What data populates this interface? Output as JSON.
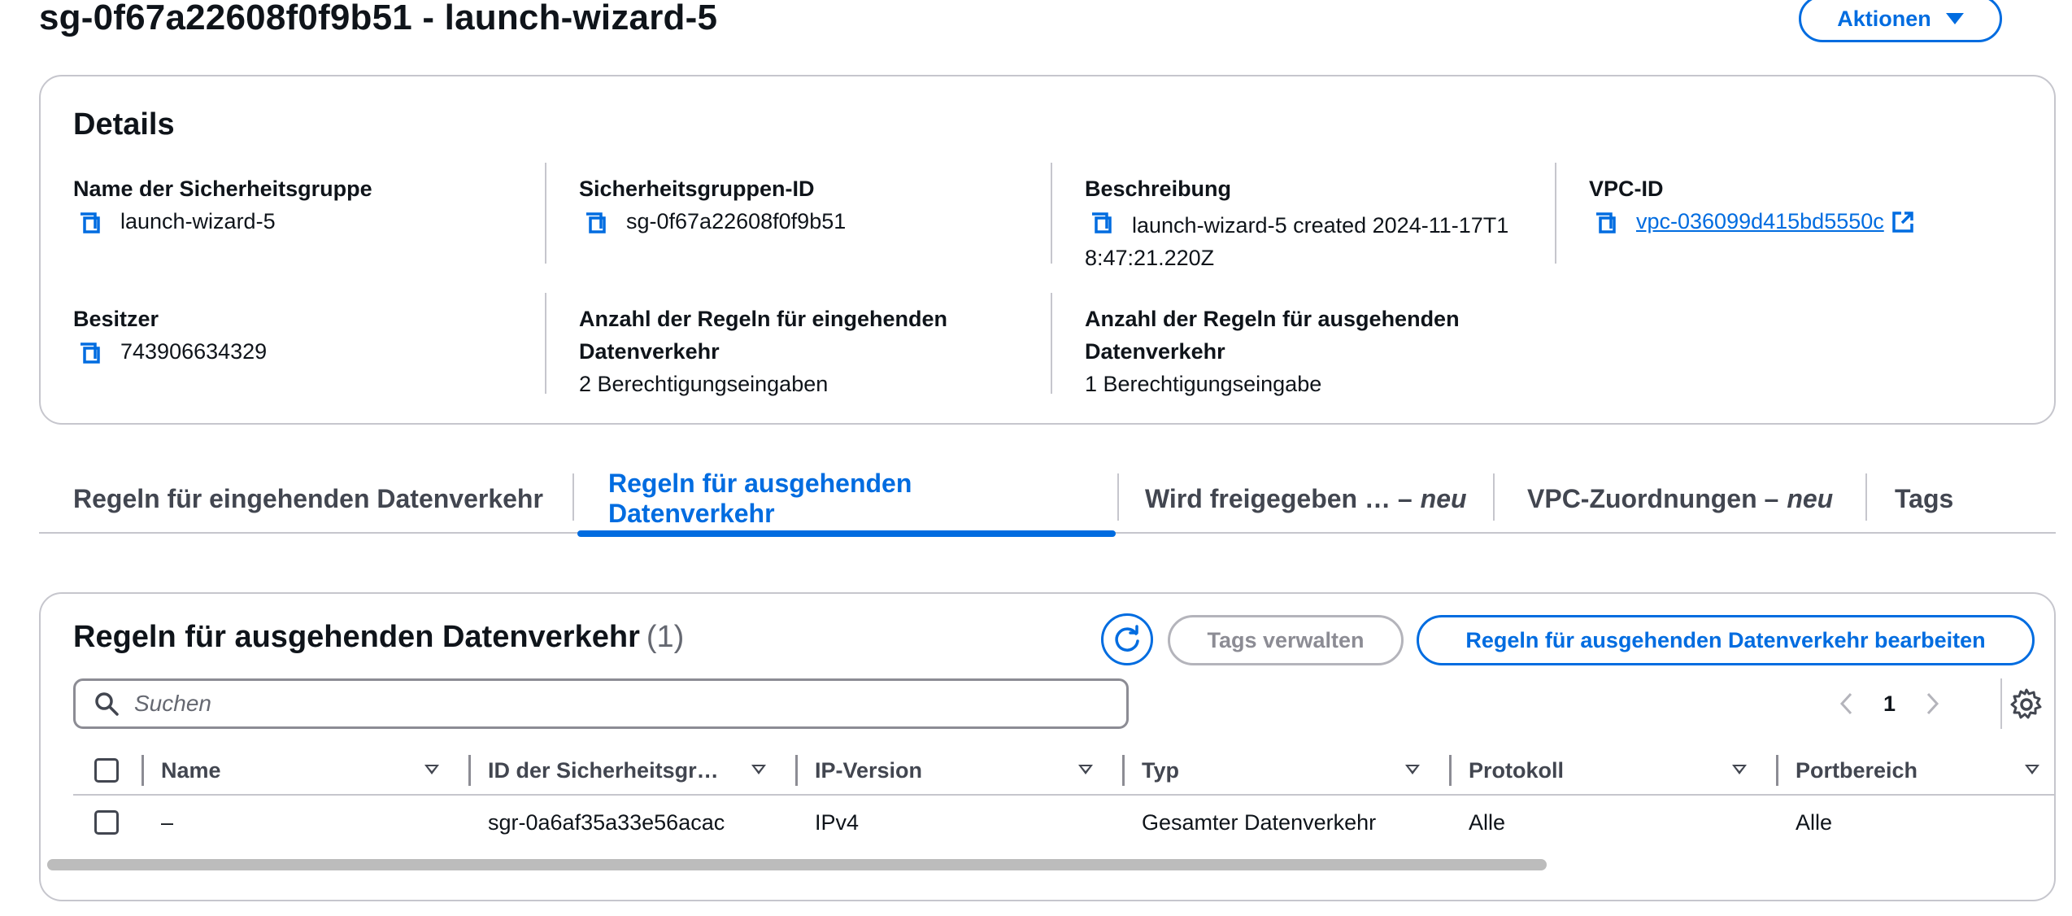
{
  "header": {
    "title": "sg-0f67a22608f0f9b51 - launch-wizard-5",
    "actions_label": "Aktionen"
  },
  "details": {
    "heading": "Details",
    "name_label": "Name der Sicherheitsgruppe",
    "name_value": "launch-wizard-5",
    "id_label": "Sicherheitsgruppen-ID",
    "id_value": "sg-0f67a22608f0f9b51",
    "description_label": "Beschreibung",
    "description_value": "launch-wizard-5 created 2024-11-17T18:47:21.220Z",
    "vpc_label": "VPC-ID",
    "vpc_value": "vpc-036099d415bd5550c",
    "owner_label": "Besitzer",
    "owner_value": "743906634329",
    "inbound_count_label": "Anzahl der Regeln für eingehenden Datenverkehr",
    "inbound_count_value": "2 Berechtigungseingaben",
    "outbound_count_label": "Anzahl der Regeln für ausgehenden Datenverkehr",
    "outbound_count_value": "1 Berechtigungseingabe"
  },
  "tabs": [
    {
      "label": "Regeln für eingehenden Datenverkehr",
      "suffix": ""
    },
    {
      "label": "Regeln für ausgehenden Datenverkehr",
      "suffix": ""
    },
    {
      "label": "Wird freigegeben … –",
      "suffix": "neu"
    },
    {
      "label": "VPC-Zuordnungen –",
      "suffix": "neu"
    },
    {
      "label": "Tags",
      "suffix": ""
    }
  ],
  "active_tab": 1,
  "rules": {
    "heading": "Regeln für ausgehenden Datenverkehr",
    "count": "(1)",
    "manage_tags_label": "Tags verwalten",
    "edit_label": "Regeln für ausgehenden Datenverkehr bearbeiten",
    "search_placeholder": "Suchen",
    "page_number": "1",
    "columns": [
      "Name",
      "ID der Sicherheitsgr…",
      "IP-Version",
      "Typ",
      "Protokoll",
      "Portbereich"
    ],
    "rows": [
      {
        "name": "–",
        "id": "sgr-0a6af35a33e56acac",
        "ip_version": "IPv4",
        "type": "Gesamter Datenverkehr",
        "protocol": "Alle",
        "port_range": "Alle"
      }
    ]
  },
  "colors": {
    "accent": "#006ce0",
    "text": "#0f141a",
    "border": "#c6c6cd"
  }
}
